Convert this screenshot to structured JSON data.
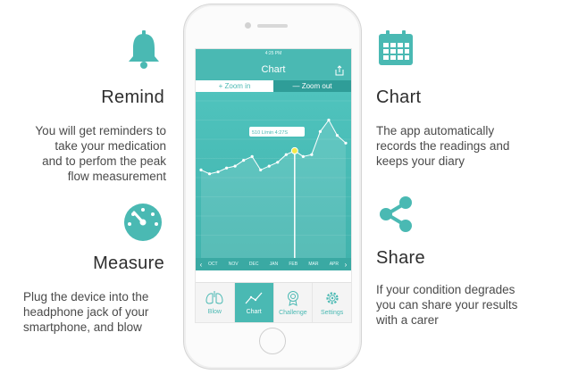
{
  "colors": {
    "accent": "#4ab9b3",
    "accent_dark": "#2f9d98",
    "text": "#3d3d3d"
  },
  "features": {
    "remind": {
      "title": "Remind",
      "text": [
        "You will get reminders to",
        "take your medication",
        "and to perfom the peak",
        "flow measurement"
      ],
      "icon": "bell-icon"
    },
    "measure": {
      "title": "Measure",
      "text": [
        "Plug the device into the",
        "headphone jack of your",
        "smartphone, and blow"
      ],
      "icon": "gauge-icon"
    },
    "chart": {
      "title": "Chart",
      "text": [
        "The app automatically",
        "records the readings and",
        "keeps your diary"
      ],
      "icon": "calendar-icon"
    },
    "share": {
      "title": "Share",
      "text": [
        "If your condition degrades",
        "you can share your results",
        "with a carer"
      ],
      "icon": "share-icon"
    }
  },
  "app": {
    "status_time": "4:25 PM",
    "nav_title": "Chart",
    "zoom_in": "+ Zoom in",
    "zoom_out": "— Zoom out",
    "tooltip": "510 L/min  4:27S",
    "months": [
      "OCT",
      "NOV",
      "DEC",
      "JAN",
      "FEB",
      "MAR",
      "APR"
    ],
    "readings": [
      320,
      310,
      315,
      325,
      330,
      345,
      355,
      320,
      330,
      340,
      360,
      370,
      355,
      360,
      420,
      450,
      410,
      390
    ],
    "tabs": [
      {
        "label": "Blow",
        "icon": "lungs-icon",
        "active": false
      },
      {
        "label": "Chart",
        "icon": "chart-icon",
        "active": true
      },
      {
        "label": "Challenge",
        "icon": "medal-icon",
        "active": false
      },
      {
        "label": "Settings",
        "icon": "gear-icon",
        "active": false
      }
    ]
  }
}
